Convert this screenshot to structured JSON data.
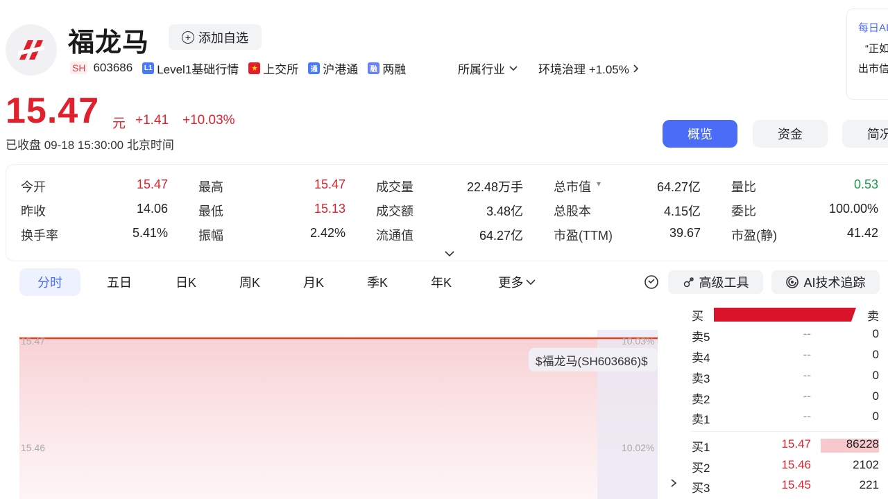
{
  "header": {
    "stock_name": "福龙马",
    "add_watchlist_label": "添加自选",
    "exchange_prefix": "SH",
    "code": "603686",
    "tags": [
      {
        "badge": "L1",
        "label": "Level1基础行情",
        "color": "#4a7bf7"
      },
      {
        "badge": "",
        "label": "上交所",
        "color": "#e0202c"
      },
      {
        "badge": "通",
        "label": "沪港通",
        "color": "#4a7bf7"
      },
      {
        "badge": "融",
        "label": "两融",
        "color": "#4a7bf7"
      }
    ],
    "industry_label": "所属行业",
    "sector_label": "环境治理 +1.05%"
  },
  "quote": {
    "price": "15.47",
    "unit": "元",
    "change": "+1.41",
    "change_pct": "+10.03%",
    "status": "已收盘 09-18 15:30:00 北京时间"
  },
  "top_tabs": {
    "overview": "概览",
    "fund": "资金",
    "brief": "简况"
  },
  "ai_card": {
    "title": "每日AI",
    "line1": "“正如",
    "line2": "出市信"
  },
  "stats": [
    [
      {
        "label": "今开",
        "value": "15.47",
        "color": "red"
      },
      {
        "label": "最高",
        "value": "15.47",
        "color": "red"
      },
      {
        "label": "成交量",
        "value": "22.48万手",
        "color": ""
      },
      {
        "label": "总市值",
        "value": "64.27亿",
        "color": ""
      },
      {
        "label": "量比",
        "value": "0.53",
        "color": "green"
      }
    ],
    [
      {
        "label": "昨收",
        "value": "14.06",
        "color": ""
      },
      {
        "label": "最低",
        "value": "15.13",
        "color": "red"
      },
      {
        "label": "成交额",
        "value": "3.48亿",
        "color": ""
      },
      {
        "label": "总股本",
        "value": "4.15亿",
        "color": ""
      },
      {
        "label": "委比",
        "value": "100.00%",
        "color": ""
      }
    ],
    [
      {
        "label": "换手率",
        "value": "5.41%",
        "color": ""
      },
      {
        "label": "振幅",
        "value": "2.42%",
        "color": ""
      },
      {
        "label": "流通值",
        "value": "64.27亿",
        "color": ""
      },
      {
        "label": "市盈(TTM)",
        "value": "39.67",
        "color": ""
      },
      {
        "label": "市盈(静)",
        "value": "41.42",
        "color": ""
      }
    ]
  ],
  "period_tabs": [
    "分时",
    "五日",
    "日K",
    "周K",
    "月K",
    "季K",
    "年K",
    "更多"
  ],
  "tools": {
    "advanced": "高级工具",
    "ai_tracking": "AI技术追踪"
  },
  "chart": {
    "y_top_left": "15.47",
    "y_top_right": "10.03%",
    "y_mid_left": "15.46",
    "y_mid_right": "10.02%",
    "tooltip": "$福龙马(SH603686)$"
  },
  "order_book": {
    "header_buy": "买",
    "header_sell": "卖",
    "buy_ratio": 1.0,
    "asks": [
      {
        "label": "卖5",
        "price": "--",
        "volume": "0"
      },
      {
        "label": "卖4",
        "price": "--",
        "volume": "0"
      },
      {
        "label": "卖3",
        "price": "--",
        "volume": "0"
      },
      {
        "label": "卖2",
        "price": "--",
        "volume": "0"
      },
      {
        "label": "卖1",
        "price": "--",
        "volume": "0"
      }
    ],
    "bids": [
      {
        "label": "买1",
        "price": "15.47",
        "volume": "86228",
        "share": 1.0
      },
      {
        "label": "买2",
        "price": "15.46",
        "volume": "2102",
        "share": 0.0
      },
      {
        "label": "买3",
        "price": "15.45",
        "volume": "221",
        "share": 0.0
      }
    ]
  },
  "colors": {
    "accent": "#4a6cf7",
    "up": "#e0202c",
    "down": "#1a9a4a"
  }
}
